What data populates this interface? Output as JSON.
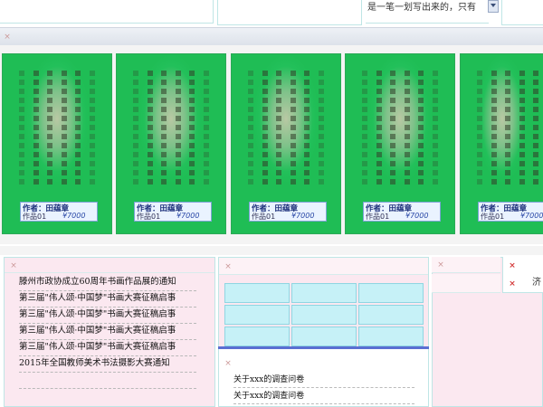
{
  "top": {
    "snippet": "是一笔一划写出来的，只有"
  },
  "gallery": {
    "cards": [
      {
        "author": "作者：田蕴章",
        "work": "作品01",
        "price": "¥7000"
      },
      {
        "author": "作者：田蕴章",
        "work": "作品01",
        "price": "¥7000"
      },
      {
        "author": "作者：田蕴章",
        "work": "作品01",
        "price": "¥7000"
      },
      {
        "author": "作者：田蕴章",
        "work": "作品01",
        "price": "¥7000"
      },
      {
        "author": "作者：田蕴章",
        "work": "作品01",
        "price": "¥7000"
      }
    ]
  },
  "news": {
    "items": [
      "滕州市政协成立60周年书画作品展的通知",
      "第三届\"伟人颂·中国梦\"书画大赛征稿启事",
      "第三届\"伟人颂·中国梦\"书画大赛征稿启事",
      "第三届\"伟人颂·中国梦\"书画大赛征稿启事",
      "第三届\"伟人颂·中国梦\"书画大赛征稿启事",
      "2015年全国教师美术书法摄影大赛通知"
    ]
  },
  "survey": {
    "items": [
      "关于xxx的调查问卷",
      "关于xxx的调查问卷"
    ]
  },
  "right": {
    "glyph": "济"
  },
  "colors": {
    "card_green": "#1fbd55",
    "panel_pink": "#fbe8f0",
    "cell_cyan": "#c6f1f7",
    "divider_blue": "#5a6fd2"
  }
}
